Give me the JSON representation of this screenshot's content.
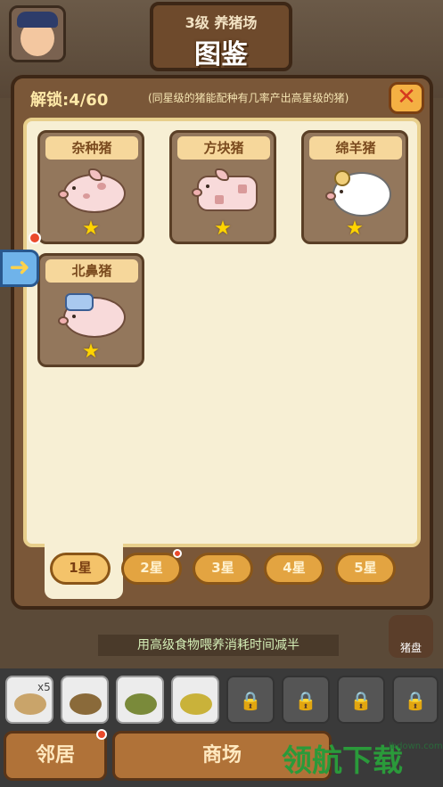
{
  "header": {
    "subtitle": "3级 养猪场",
    "title": "图鉴"
  },
  "panel": {
    "unlock_label": "解锁:4/60",
    "hint": "(同星级的猪能配种有几率产出高星级的猪)",
    "close_icon": "close-icon"
  },
  "cards": [
    {
      "name": "杂种猪",
      "stars": 1,
      "icon": "spotted-pig"
    },
    {
      "name": "方块猪",
      "stars": 1,
      "icon": "square-pig"
    },
    {
      "name": "绵羊猪",
      "stars": 1,
      "icon": "sheep-pig"
    },
    {
      "name": "北鼻猪",
      "stars": 1,
      "icon": "baby-pig"
    }
  ],
  "star_glyph": "★",
  "side_arrow": "➜",
  "tabs": [
    {
      "label": "1星",
      "active": true
    },
    {
      "label": "2星",
      "active": false,
      "badge": true
    },
    {
      "label": "3星",
      "active": false
    },
    {
      "label": "4星",
      "active": false
    },
    {
      "label": "5星",
      "active": false
    }
  ],
  "status_text": "用高级食物喂养消耗时间减半",
  "side_button_label": "猪盘",
  "inventory": {
    "first_count": "x5",
    "lock_glyph": "🔒"
  },
  "bottom": {
    "neighbors": "邻居",
    "shop": "商场"
  },
  "watermark": {
    "text": "领航下载",
    "url": "lhdown.com"
  },
  "colors": {
    "accent": "#f4b043",
    "panel": "#7a5738",
    "inner": "#f7efd4",
    "badge": "#ea4a2c"
  }
}
